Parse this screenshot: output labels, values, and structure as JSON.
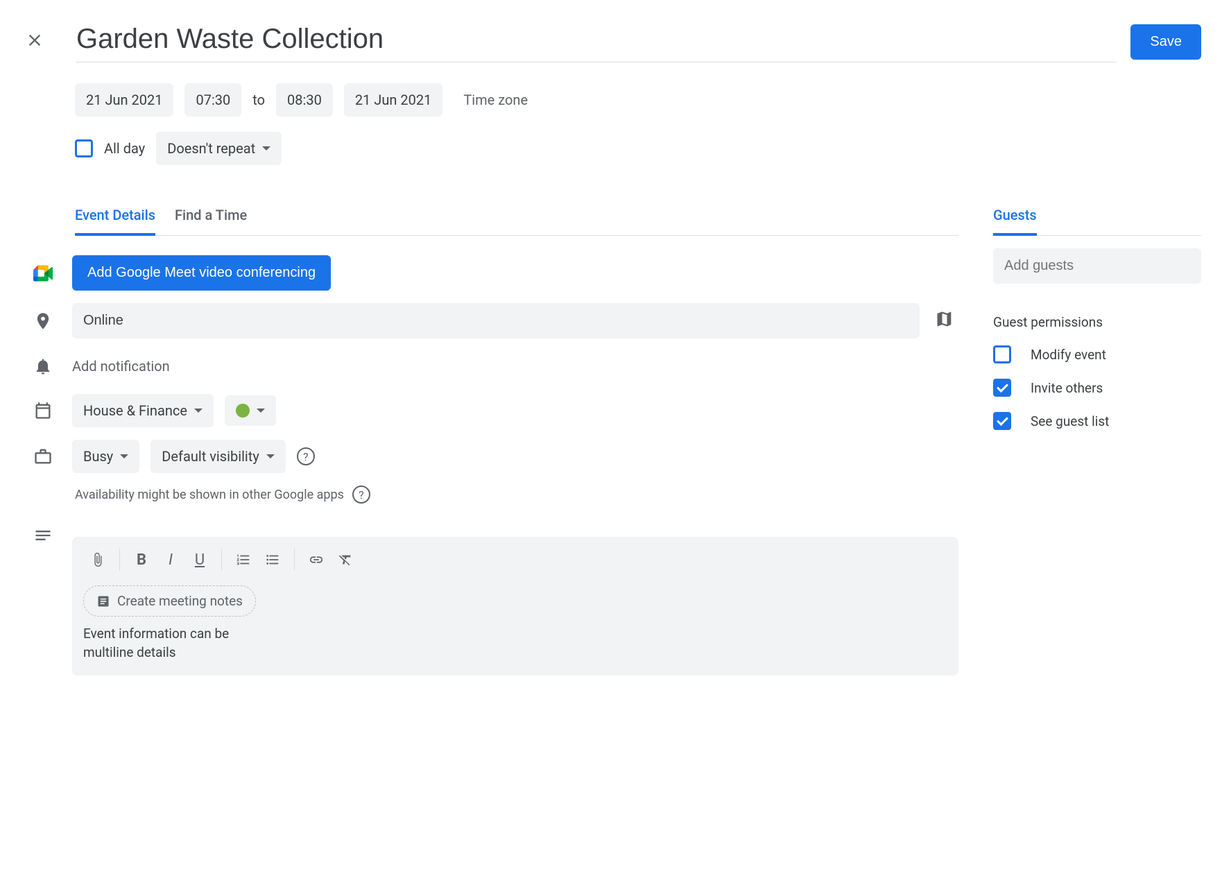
{
  "header": {
    "title": "Garden Waste Collection",
    "save_label": "Save"
  },
  "datetime": {
    "start_date": "21 Jun 2021",
    "start_time": "07:30",
    "to": "to",
    "end_time": "08:30",
    "end_date": "21 Jun 2021",
    "timezone_label": "Time zone"
  },
  "allday": {
    "label": "All day",
    "repeat": "Doesn't repeat"
  },
  "tabs": {
    "details": "Event Details",
    "findtime": "Find a Time"
  },
  "meet": {
    "label": "Add Google Meet video conferencing"
  },
  "location": {
    "value": "Online"
  },
  "notification": {
    "add_label": "Add notification"
  },
  "calendar": {
    "name": "House & Finance",
    "color": "#8a9a28"
  },
  "visibility": {
    "busy": "Busy",
    "default": "Default visibility"
  },
  "availability_note": "Availability might be shown in other Google apps",
  "description": {
    "create_notes": "Create meeting notes",
    "text": "Event information can be\nmultiline details"
  },
  "guests": {
    "tab": "Guests",
    "placeholder": "Add guests",
    "permissions_title": "Guest permissions",
    "modify": "Modify event",
    "invite": "Invite others",
    "see_list": "See guest list"
  }
}
